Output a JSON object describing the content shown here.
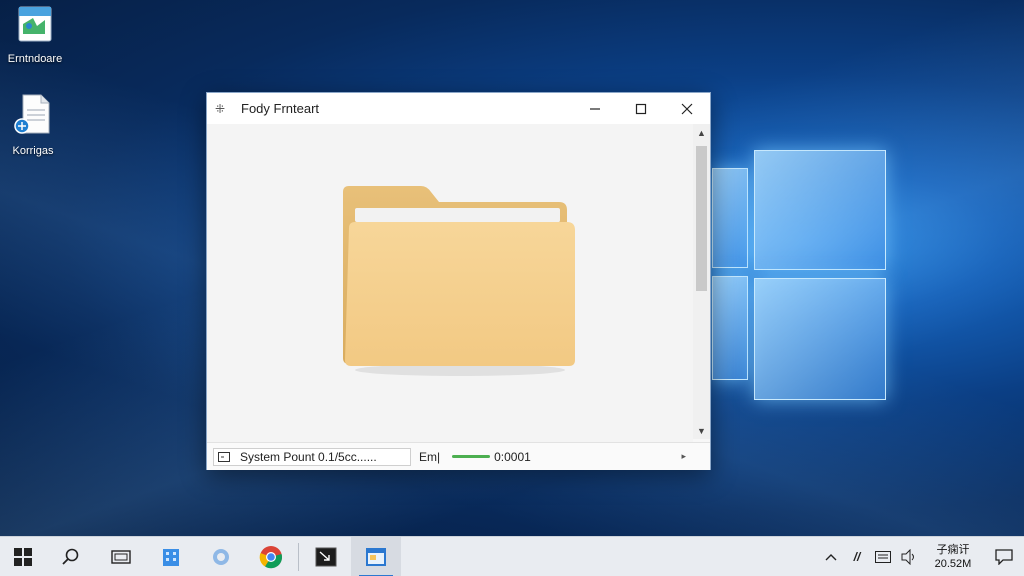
{
  "desktop": {
    "icons": [
      {
        "label": "Erntndoare"
      },
      {
        "label": "Korrigas"
      }
    ]
  },
  "window": {
    "title": "Fody Frnteart",
    "status_text": "System Pount 0.1/5cc......",
    "status_label": "Em|",
    "status_value": "0:0001"
  },
  "taskbar": {
    "clock_line1": "子痫讦",
    "clock_line2": "20.52M"
  },
  "colors": {
    "accent": "#2b78d0",
    "folder": "#f3cf8a",
    "progress": "#4caf50"
  }
}
